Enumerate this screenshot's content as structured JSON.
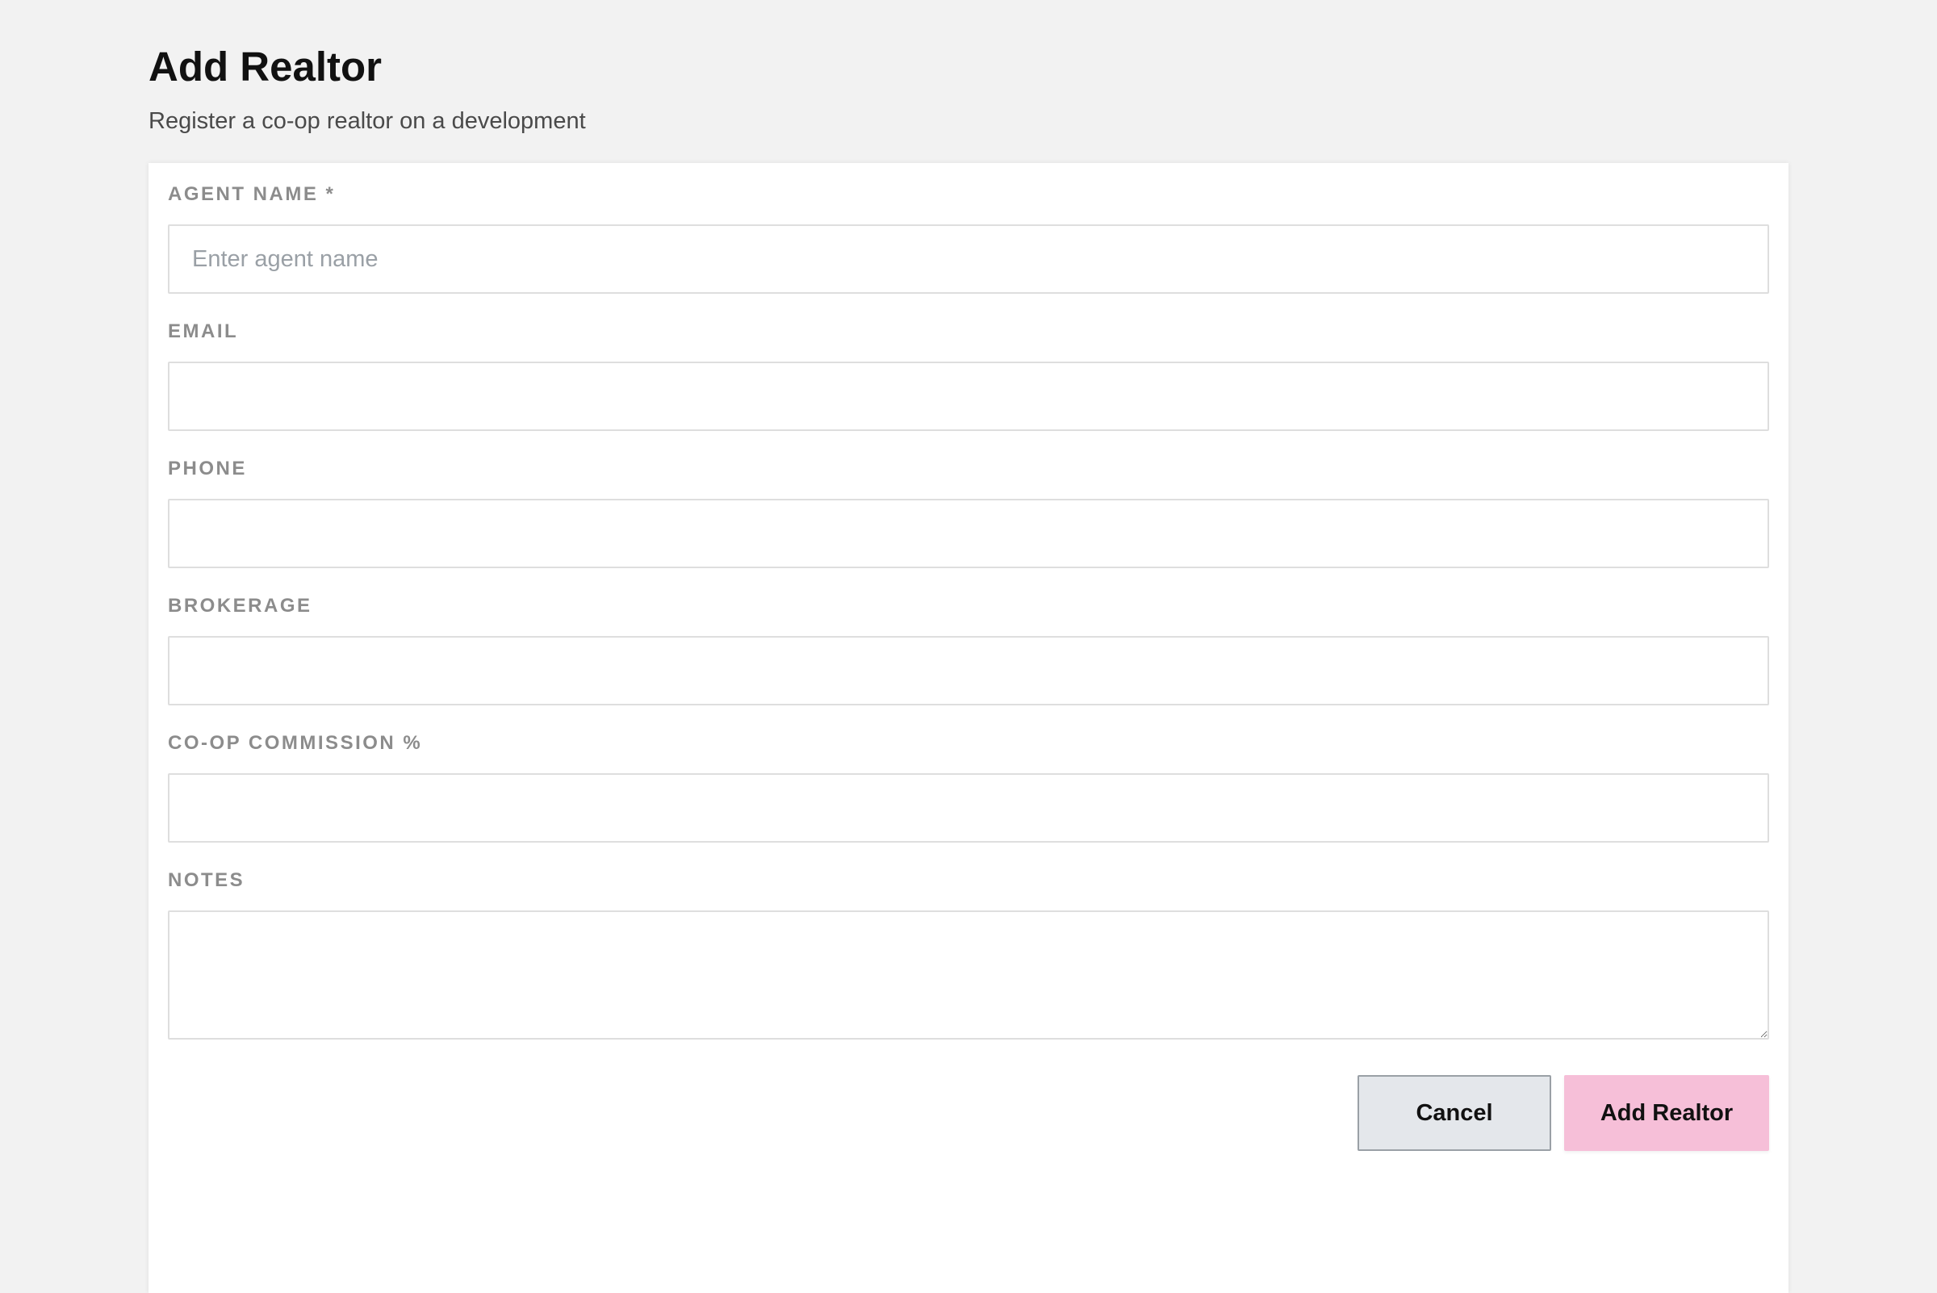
{
  "header": {
    "title": "Add Realtor",
    "subtitle": "Register a co-op realtor on a development"
  },
  "form": {
    "fields": [
      {
        "label": "AGENT NAME *",
        "placeholder": "Enter agent name",
        "value": ""
      },
      {
        "label": "EMAIL",
        "placeholder": "",
        "value": ""
      },
      {
        "label": "PHONE",
        "placeholder": "",
        "value": ""
      },
      {
        "label": "BROKERAGE",
        "placeholder": "",
        "value": ""
      },
      {
        "label": "CO-OP COMMISSION %",
        "placeholder": "",
        "value": ""
      },
      {
        "label": "NOTES",
        "placeholder": "",
        "value": ""
      }
    ],
    "actions": {
      "cancel_label": "Cancel",
      "submit_label": "Add Realtor"
    }
  },
  "colors": {
    "background": "#f2f2f2",
    "card": "#ffffff",
    "label": "#8c8c8c",
    "input_border": "#dedede",
    "cancel_bg": "#e4e7eb",
    "submit_bg": "#f6bfd8"
  }
}
